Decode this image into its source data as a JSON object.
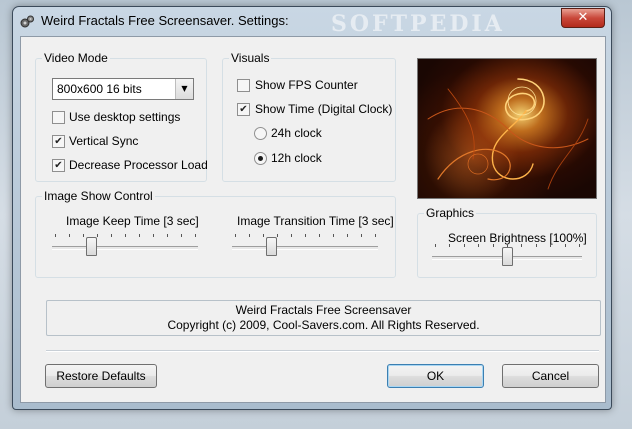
{
  "window": {
    "title": "Weird Fractals Free Screensaver. Settings:",
    "watermark": "SOFTPEDIA",
    "close_glyph": "✕"
  },
  "video_mode": {
    "legend": "Video Mode",
    "resolution_value": "800x600 16 bits",
    "use_desktop_settings": {
      "label": "Use desktop settings",
      "checked": false
    },
    "vertical_sync": {
      "label": "Vertical Sync",
      "checked": true
    },
    "decrease_processor_load": {
      "label": "Decrease Processor Load",
      "checked": true
    }
  },
  "visuals": {
    "legend": "Visuals",
    "show_fps_counter": {
      "label": "Show FPS Counter",
      "checked": false
    },
    "show_time": {
      "label": "Show Time (Digital Clock)",
      "checked": true
    },
    "clock_24h": {
      "label": "24h clock",
      "selected": false
    },
    "clock_12h": {
      "label": "12h clock",
      "selected": true
    }
  },
  "image_show_control": {
    "legend": "Image Show Control",
    "keep_time_label": "Image Keep Time [3 sec]",
    "keep_time_level": 0.25,
    "transition_time_label": "Image Transition Time [3 sec]",
    "transition_time_level": 0.25
  },
  "graphics": {
    "legend": "Graphics",
    "brightness_label": "Screen Brightness [100%]",
    "brightness_level": 0.5
  },
  "info": {
    "line1": "Weird Fractals Free Screensaver",
    "line2": "Copyright (c) 2009, Cool-Savers.com. All Rights Reserved."
  },
  "buttons": {
    "restore_defaults": "Restore Defaults",
    "ok": "OK",
    "cancel": "Cancel"
  },
  "icons": {
    "window_icon": "gears-icon",
    "dropdown_arrow": "chevron-down-icon",
    "check": "✔"
  }
}
